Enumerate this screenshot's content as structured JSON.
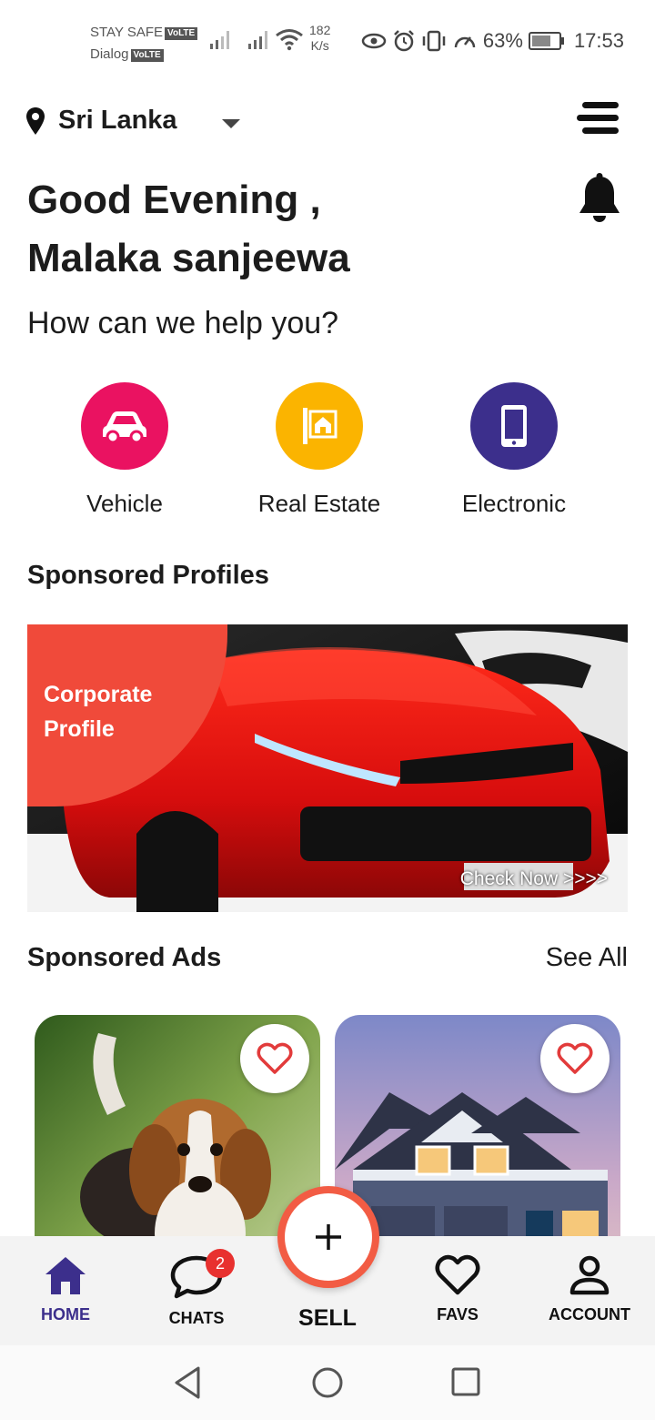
{
  "status_bar": {
    "carrier_1": "STAY SAFE",
    "carrier_2": "Dialog",
    "volte": "VoLTE",
    "speed_value": "182",
    "speed_unit": "K/s",
    "battery": "63%",
    "time": "17:53"
  },
  "header": {
    "location": "Sri Lanka",
    "greeting_line1": "Good Evening ,",
    "greeting_line2": "Malaka sanjeewa",
    "help_text": "How can we help you?"
  },
  "categories": [
    {
      "label": "Vehicle",
      "icon": "car-icon",
      "color": "#ea1261"
    },
    {
      "label": "Real Estate",
      "icon": "building-icon",
      "color": "#fbb400"
    },
    {
      "label": "Electronic",
      "icon": "phone-icon",
      "color": "#3c2f8c"
    }
  ],
  "sponsored_profiles": {
    "title": "Sponsored Profiles",
    "banner_label_line1": "Corporate",
    "banner_label_line2": "Profile",
    "banner_cta": "Check Now >>>>",
    "accent": "#f04a3a"
  },
  "sponsored_ads": {
    "title": "Sponsored Ads",
    "see_all": "See All"
  },
  "bottom_nav": {
    "home": "HOME",
    "chats": "CHATS",
    "chats_badge": "2",
    "sell": "SELL",
    "favs": "FAVS",
    "account": "ACCOUNT",
    "active_color": "#3c2f8c",
    "fab_color": "#f25c44"
  }
}
